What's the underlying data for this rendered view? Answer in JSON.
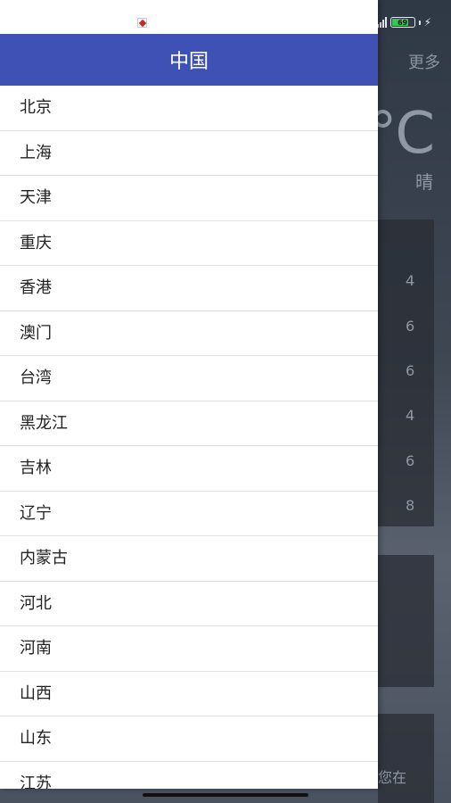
{
  "status_bar": {
    "battery_level": "69"
  },
  "background": {
    "more_label": "更多",
    "temperature": "°C",
    "condition": "晴",
    "values": [
      "4",
      "6",
      "6",
      "4",
      "6",
      "8"
    ],
    "bottom_text": "您在"
  },
  "drawer": {
    "title": "中国",
    "items": [
      "北京",
      "上海",
      "天津",
      "重庆",
      "香港",
      "澳门",
      "台湾",
      "黑龙江",
      "吉林",
      "辽宁",
      "内蒙古",
      "河北",
      "河南",
      "山西",
      "山东",
      "江苏"
    ]
  },
  "colors": {
    "header": "#3f51b5",
    "battery": "#35c759"
  }
}
